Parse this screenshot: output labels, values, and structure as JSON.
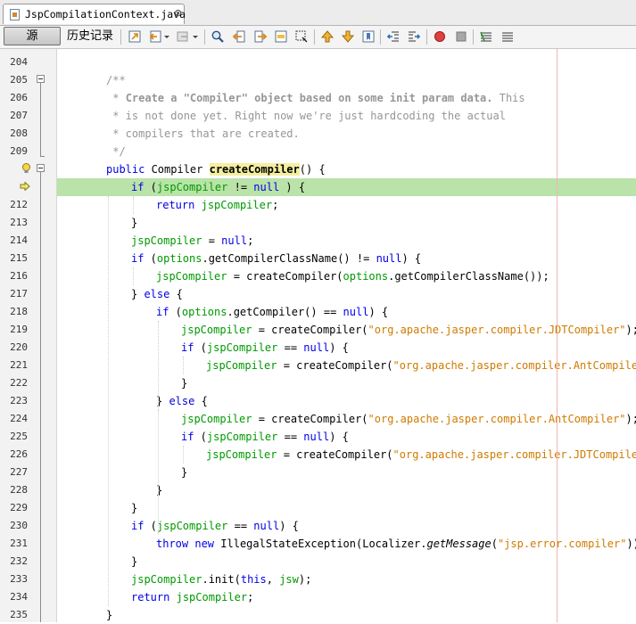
{
  "tab": {
    "title": "JspCompilationContext.java",
    "close": "⊗"
  },
  "toolbar": {
    "source_label": "源",
    "history_label": "历史记录"
  },
  "editor": {
    "lines": [
      {
        "num": "204",
        "indent": 0,
        "tokens": []
      },
      {
        "num": "205",
        "indent": 1,
        "tokens": [
          {
            "t": "/**",
            "c": "cm"
          }
        ]
      },
      {
        "num": "206",
        "indent": 1,
        "tokens": [
          {
            "t": " * ",
            "c": "cm"
          },
          {
            "t": "Create a \"Compiler\" object based on some init param data.",
            "c": "cmb"
          },
          {
            "t": " This",
            "c": "cm"
          }
        ]
      },
      {
        "num": "207",
        "indent": 1,
        "tokens": [
          {
            "t": " * is not done yet. Right now we're just hardcoding the actual",
            "c": "cm"
          }
        ]
      },
      {
        "num": "208",
        "indent": 1,
        "tokens": [
          {
            "t": " * compilers that are created.",
            "c": "cm"
          }
        ]
      },
      {
        "num": "209",
        "indent": 1,
        "tokens": [
          {
            "t": " */",
            "c": "cm"
          }
        ]
      },
      {
        "num": "",
        "indent": 1,
        "tokens": [
          {
            "t": "public",
            "c": "kw"
          },
          {
            "t": " Compiler ",
            "c": ""
          },
          {
            "t": "createCompiler",
            "c": "mth"
          },
          {
            "t": "() {",
            "c": ""
          }
        ]
      },
      {
        "num": "",
        "indent": 2,
        "tokens": [
          {
            "t": "if",
            "c": "kw"
          },
          {
            "t": " (",
            "c": ""
          },
          {
            "t": "jspCompiler",
            "c": "fld"
          },
          {
            "t": " != ",
            "c": ""
          },
          {
            "t": "null",
            "c": "kw"
          },
          {
            "t": " ) {",
            "c": ""
          }
        ]
      },
      {
        "num": "212",
        "indent": 3,
        "tokens": [
          {
            "t": "return",
            "c": "kw"
          },
          {
            "t": " ",
            "c": ""
          },
          {
            "t": "jspCompiler",
            "c": "fld"
          },
          {
            "t": ";",
            "c": ""
          }
        ]
      },
      {
        "num": "213",
        "indent": 2,
        "tokens": [
          {
            "t": "}",
            "c": ""
          }
        ]
      },
      {
        "num": "214",
        "indent": 2,
        "tokens": [
          {
            "t": "jspCompiler",
            "c": "fld"
          },
          {
            "t": " = ",
            "c": ""
          },
          {
            "t": "null",
            "c": "kw"
          },
          {
            "t": ";",
            "c": ""
          }
        ]
      },
      {
        "num": "215",
        "indent": 2,
        "tokens": [
          {
            "t": "if",
            "c": "kw"
          },
          {
            "t": " (",
            "c": ""
          },
          {
            "t": "options",
            "c": "fld"
          },
          {
            "t": ".getCompilerClassName() != ",
            "c": ""
          },
          {
            "t": "null",
            "c": "kw"
          },
          {
            "t": ") {",
            "c": ""
          }
        ]
      },
      {
        "num": "216",
        "indent": 3,
        "tokens": [
          {
            "t": "jspCompiler",
            "c": "fld"
          },
          {
            "t": " = createCompiler(",
            "c": ""
          },
          {
            "t": "options",
            "c": "fld"
          },
          {
            "t": ".getCompilerClassName());",
            "c": ""
          }
        ]
      },
      {
        "num": "217",
        "indent": 2,
        "tokens": [
          {
            "t": "} ",
            "c": ""
          },
          {
            "t": "else",
            "c": "kw"
          },
          {
            "t": " {",
            "c": ""
          }
        ]
      },
      {
        "num": "218",
        "indent": 3,
        "tokens": [
          {
            "t": "if",
            "c": "kw"
          },
          {
            "t": " (",
            "c": ""
          },
          {
            "t": "options",
            "c": "fld"
          },
          {
            "t": ".getCompiler() == ",
            "c": ""
          },
          {
            "t": "null",
            "c": "kw"
          },
          {
            "t": ") {",
            "c": ""
          }
        ]
      },
      {
        "num": "219",
        "indent": 4,
        "tokens": [
          {
            "t": "jspCompiler",
            "c": "fld"
          },
          {
            "t": " = createCompiler(",
            "c": ""
          },
          {
            "t": "\"org.apache.jasper.compiler.JDTCompiler\"",
            "c": "str"
          },
          {
            "t": ");",
            "c": ""
          }
        ]
      },
      {
        "num": "220",
        "indent": 4,
        "tokens": [
          {
            "t": "if",
            "c": "kw"
          },
          {
            "t": " (",
            "c": ""
          },
          {
            "t": "jspCompiler",
            "c": "fld"
          },
          {
            "t": " == ",
            "c": ""
          },
          {
            "t": "null",
            "c": "kw"
          },
          {
            "t": ") {",
            "c": ""
          }
        ]
      },
      {
        "num": "221",
        "indent": 5,
        "tokens": [
          {
            "t": "jspCompiler",
            "c": "fld"
          },
          {
            "t": " = createCompiler(",
            "c": ""
          },
          {
            "t": "\"org.apache.jasper.compiler.AntCompiler\"",
            "c": "str"
          },
          {
            "t": ");",
            "c": ""
          }
        ]
      },
      {
        "num": "222",
        "indent": 4,
        "tokens": [
          {
            "t": "}",
            "c": ""
          }
        ]
      },
      {
        "num": "223",
        "indent": 3,
        "tokens": [
          {
            "t": "} ",
            "c": ""
          },
          {
            "t": "else",
            "c": "kw"
          },
          {
            "t": " {",
            "c": ""
          }
        ]
      },
      {
        "num": "224",
        "indent": 4,
        "tokens": [
          {
            "t": "jspCompiler",
            "c": "fld"
          },
          {
            "t": " = createCompiler(",
            "c": ""
          },
          {
            "t": "\"org.apache.jasper.compiler.AntCompiler\"",
            "c": "str"
          },
          {
            "t": ");",
            "c": ""
          }
        ]
      },
      {
        "num": "225",
        "indent": 4,
        "tokens": [
          {
            "t": "if",
            "c": "kw"
          },
          {
            "t": " (",
            "c": ""
          },
          {
            "t": "jspCompiler",
            "c": "fld"
          },
          {
            "t": " == ",
            "c": ""
          },
          {
            "t": "null",
            "c": "kw"
          },
          {
            "t": ") {",
            "c": ""
          }
        ]
      },
      {
        "num": "226",
        "indent": 5,
        "tokens": [
          {
            "t": "jspCompiler",
            "c": "fld"
          },
          {
            "t": " = createCompiler(",
            "c": ""
          },
          {
            "t": "\"org.apache.jasper.compiler.JDTCompiler\"",
            "c": "str"
          },
          {
            "t": ");",
            "c": ""
          }
        ]
      },
      {
        "num": "227",
        "indent": 4,
        "tokens": [
          {
            "t": "}",
            "c": ""
          }
        ]
      },
      {
        "num": "228",
        "indent": 3,
        "tokens": [
          {
            "t": "}",
            "c": ""
          }
        ]
      },
      {
        "num": "229",
        "indent": 2,
        "tokens": [
          {
            "t": "}",
            "c": ""
          }
        ]
      },
      {
        "num": "230",
        "indent": 2,
        "tokens": [
          {
            "t": "if",
            "c": "kw"
          },
          {
            "t": " (",
            "c": ""
          },
          {
            "t": "jspCompiler",
            "c": "fld"
          },
          {
            "t": " == ",
            "c": ""
          },
          {
            "t": "null",
            "c": "kw"
          },
          {
            "t": ") {",
            "c": ""
          }
        ]
      },
      {
        "num": "231",
        "indent": 3,
        "tokens": [
          {
            "t": "throw",
            "c": "kw"
          },
          {
            "t": " ",
            "c": ""
          },
          {
            "t": "new",
            "c": "kw"
          },
          {
            "t": " IllegalStateException(Localizer.",
            "c": ""
          },
          {
            "t": "getMessage",
            "c": "it"
          },
          {
            "t": "(",
            "c": ""
          },
          {
            "t": "\"jsp.error.compiler\"",
            "c": "str"
          },
          {
            "t": "));",
            "c": ""
          }
        ]
      },
      {
        "num": "232",
        "indent": 2,
        "tokens": [
          {
            "t": "}",
            "c": ""
          }
        ]
      },
      {
        "num": "233",
        "indent": 2,
        "tokens": [
          {
            "t": "jspCompiler",
            "c": "fld"
          },
          {
            "t": ".init(",
            "c": ""
          },
          {
            "t": "this",
            "c": "kw"
          },
          {
            "t": ", ",
            "c": ""
          },
          {
            "t": "jsw",
            "c": "fld"
          },
          {
            "t": ");",
            "c": ""
          }
        ]
      },
      {
        "num": "234",
        "indent": 2,
        "tokens": [
          {
            "t": "return",
            "c": "kw"
          },
          {
            "t": " ",
            "c": ""
          },
          {
            "t": "jspCompiler",
            "c": "fld"
          },
          {
            "t": ";",
            "c": ""
          }
        ]
      },
      {
        "num": "235",
        "indent": 1,
        "tokens": [
          {
            "t": "}",
            "c": ""
          }
        ]
      }
    ]
  }
}
